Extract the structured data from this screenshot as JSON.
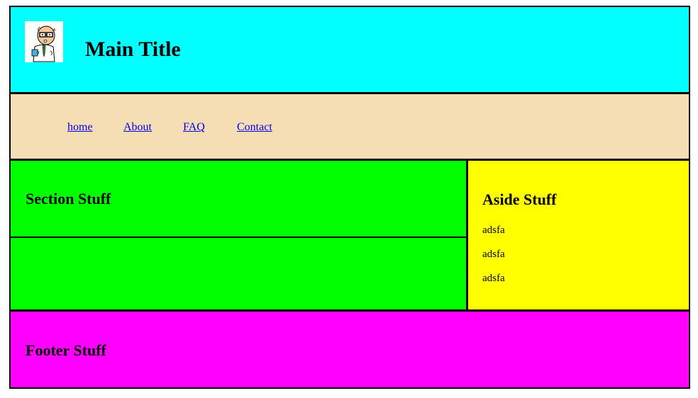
{
  "header": {
    "title": "Main Title",
    "logo_icon": "cartoon-character-icon",
    "background": "#00ffff"
  },
  "nav": {
    "background": "#f5deb3",
    "links": [
      {
        "label": "home"
      },
      {
        "label": "About"
      },
      {
        "label": "FAQ"
      },
      {
        "label": "Contact"
      }
    ]
  },
  "section": {
    "heading": "Section Stuff",
    "background": "#00ff00"
  },
  "aside": {
    "heading": "Aside Stuff",
    "background": "#ffff00",
    "items": [
      "adsfa",
      "adsfa",
      "adsfa"
    ]
  },
  "footer": {
    "heading": "Footer Stuff",
    "background": "#ff00ff"
  }
}
